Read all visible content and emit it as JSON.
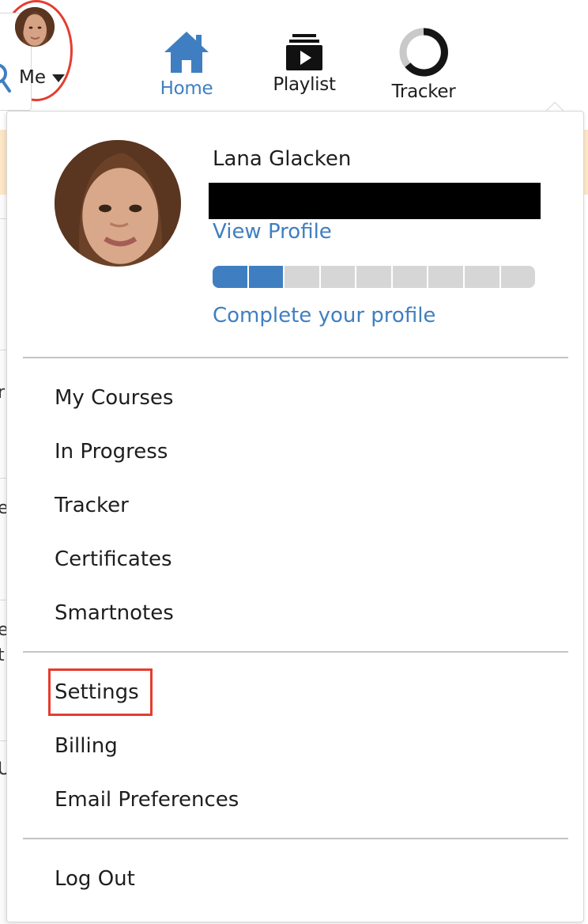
{
  "nav": {
    "home_label": "Home",
    "playlist_label": "Playlist",
    "tracker_label": "Tracker",
    "me_label": "Me"
  },
  "profile": {
    "name": "Lana Glacken",
    "view_profile": "View Profile",
    "complete_profile": "Complete your profile",
    "completion_segments_total": 9,
    "completion_segments_filled": 2
  },
  "menu": {
    "group1": [
      "My Courses",
      "In Progress",
      "Tracker",
      "Certificates",
      "Smartnotes"
    ],
    "group2": [
      "Settings",
      "Billing",
      "Email Preferences"
    ],
    "group3": [
      "Log Out"
    ]
  },
  "colors": {
    "accent": "#3f7fc1",
    "highlight": "#e43d2f",
    "banner": "#fde6c6"
  },
  "icons": {
    "search": "search-icon",
    "home": "home-icon",
    "playlist": "playlist-icon",
    "tracker": "tracker-ring-icon",
    "caret": "caret-down-icon"
  }
}
